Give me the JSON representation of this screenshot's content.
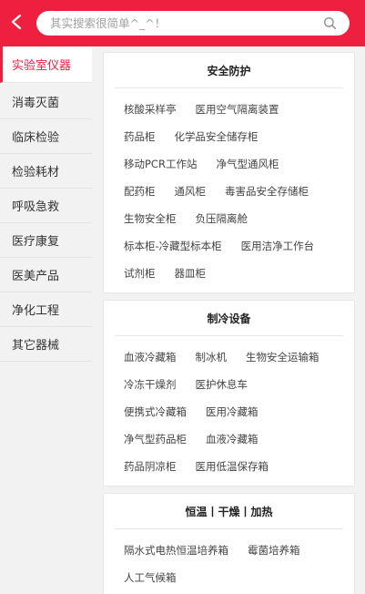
{
  "search": {
    "placeholder": "其实搜索很简单^_^！"
  },
  "sidebar": {
    "items": [
      {
        "label": "实验室仪器",
        "active": true
      },
      {
        "label": "消毒灭菌"
      },
      {
        "label": "临床检验"
      },
      {
        "label": "检验耗材"
      },
      {
        "label": "呼吸急救"
      },
      {
        "label": "医疗康复"
      },
      {
        "label": "医美产品"
      },
      {
        "label": "净化工程"
      },
      {
        "label": "其它器械"
      }
    ]
  },
  "sections": [
    {
      "title": "安全防护",
      "rows": [
        [
          "核酸采样亭",
          "医用空气隔离装置"
        ],
        [
          "药品柜",
          "化学品安全储存柜"
        ],
        [
          "移动PCR工作站",
          "净气型通风柜"
        ],
        [
          "配药柜",
          "通风柜",
          "毒害品安全存储柜"
        ],
        [
          "生物安全柜",
          "负压隔离舱"
        ],
        [
          "标本柜-冷藏型标本柜",
          "医用洁净工作台"
        ],
        [
          "试剂柜",
          "器皿柜"
        ]
      ]
    },
    {
      "title": "制冷设备",
      "rows": [
        [
          "血液冷藏箱",
          "制冰机",
          "生物安全运输箱"
        ],
        [
          "冷冻干燥剂",
          "医护休息车"
        ],
        [
          "便携式冷藏箱",
          "医用冷藏箱"
        ],
        [
          "净气型药品柜",
          "血液冷藏箱"
        ],
        [
          "药品阴凉柜",
          "医用低温保存箱"
        ]
      ]
    },
    {
      "title": "恒温丨干燥丨加热",
      "rows": [
        [
          "隔水式电热恒温培养箱",
          "霉菌培养箱"
        ],
        [
          "人工气候箱"
        ]
      ]
    }
  ],
  "colors": {
    "accent": "#ee1f3f"
  }
}
